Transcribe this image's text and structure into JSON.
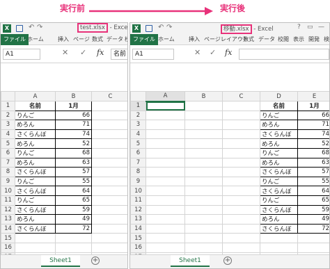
{
  "annotations": {
    "before": "実行前",
    "after": "実行後"
  },
  "left": {
    "title_file": "test.xlsx",
    "title_app": " - Excel",
    "tabs": [
      "ファイル",
      "ホーム",
      "挿入",
      "ページ",
      "数式",
      "データ",
      "校閲"
    ],
    "name_box": "A1",
    "fx": "fx",
    "formula": "名前",
    "columns": [
      "A",
      "B",
      "C"
    ],
    "rows": [
      [
        "名前",
        "1月"
      ],
      [
        "りんご",
        "66"
      ],
      [
        "めろん",
        "71"
      ],
      [
        "さくらんぼ",
        "74"
      ],
      [
        "めろん",
        "52"
      ],
      [
        "りんご",
        "68"
      ],
      [
        "めろん",
        "63"
      ],
      [
        "さくらんぼ",
        "57"
      ],
      [
        "りんご",
        "55"
      ],
      [
        "さくらんぼ",
        "64"
      ],
      [
        "りんご",
        "65"
      ],
      [
        "さくらんぼ",
        "59"
      ],
      [
        "めろん",
        "49"
      ],
      [
        "さくらんぼ",
        "72"
      ]
    ],
    "total_rows": 18,
    "sheet": "Sheet1"
  },
  "right": {
    "title_file": "移動.xlsx",
    "title_app": " - Excel",
    "window_controls": [
      "?",
      "▭",
      "—",
      "▭"
    ],
    "tabs": [
      "ファイル",
      "ホーム",
      "挿入",
      "ページレイアウト",
      "数式",
      "データ",
      "校閲",
      "表示",
      "開発",
      "検"
    ],
    "name_box": "A1",
    "fx": "fx",
    "formula": "",
    "columns": [
      "A",
      "B",
      "C",
      "D",
      "E"
    ],
    "rows": [
      [
        "名前",
        "1月"
      ],
      [
        "りんご",
        "66"
      ],
      [
        "めろん",
        "71"
      ],
      [
        "さくらんぼ",
        "74"
      ],
      [
        "めろん",
        "52"
      ],
      [
        "りんご",
        "68"
      ],
      [
        "めろん",
        "63"
      ],
      [
        "さくらんぼ",
        "57"
      ],
      [
        "りんご",
        "55"
      ],
      [
        "さくらんぼ",
        "64"
      ],
      [
        "りんご",
        "65"
      ],
      [
        "さくらんぼ",
        "59"
      ],
      [
        "めろん",
        "49"
      ],
      [
        "さくらんぼ",
        "72"
      ]
    ],
    "total_rows": 18,
    "sheet": "Sheet1"
  },
  "icons": {
    "excel": "X",
    "undo": "↶",
    "redo": "↷",
    "plus": "+",
    "cancel": "✕",
    "confirm": "✓"
  },
  "colors": {
    "accent": "#e8327a",
    "excel_green": "#217346"
  }
}
